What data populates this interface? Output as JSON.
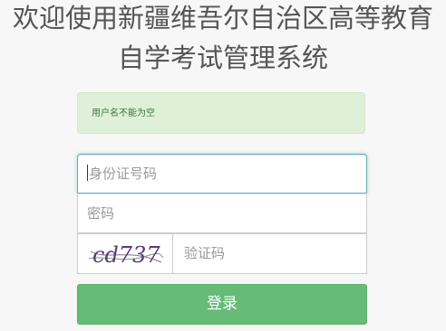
{
  "header": {
    "title_line1": "欢迎使用新疆维吾尔自治区高等教育",
    "title_line2": "自学考试管理系统"
  },
  "alert": {
    "message": "用户名不能为空"
  },
  "form": {
    "id_placeholder": "身份证号码",
    "password_placeholder": "密码",
    "captcha_placeholder": "验证码",
    "captcha_text": "cd737",
    "login_label": "登录"
  },
  "colors": {
    "alert_bg": "#dff0d8",
    "alert_text": "#3c763d",
    "focus_border": "#66afaf",
    "login_button": "#66bb77",
    "title_text": "#555555"
  }
}
